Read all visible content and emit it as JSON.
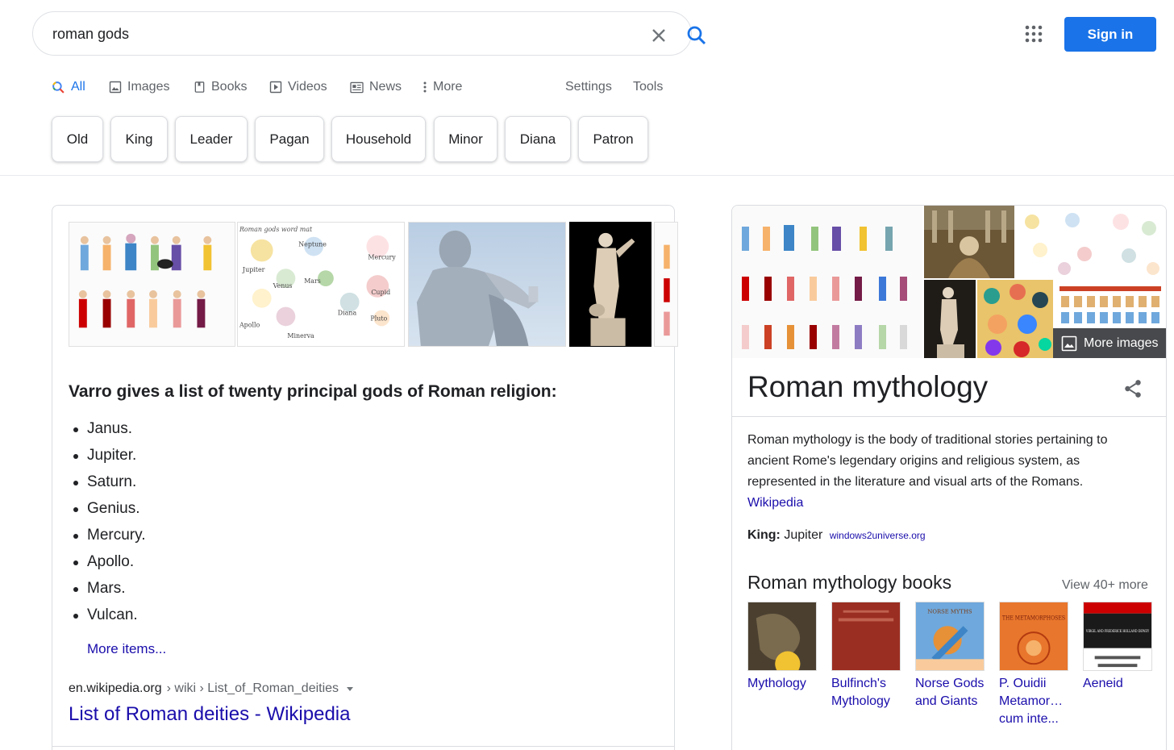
{
  "search": {
    "query": "roman gods"
  },
  "header": {
    "sign_in": "Sign in"
  },
  "tabs": {
    "all": "All",
    "images": "Images",
    "books": "Books",
    "videos": "Videos",
    "news": "News",
    "more": "More",
    "settings": "Settings",
    "tools": "Tools"
  },
  "chips": [
    "Old",
    "King",
    "Leader",
    "Pagan",
    "Household",
    "Minor",
    "Diana",
    "Patron"
  ],
  "featured_snippet": {
    "heading": "Varro gives a list of twenty principal gods of Roman religion:",
    "items": [
      "Janus.",
      "Jupiter.",
      "Saturn.",
      "Genius.",
      "Mercury.",
      "Apollo.",
      "Mars.",
      "Vulcan."
    ],
    "more_items": "More items...",
    "breadcrumb_domain": "en.wikipedia.org",
    "breadcrumb_path": "› wiki › List_of_Roman_deities",
    "result_title": "List of Roman deities - Wikipedia",
    "thumbnail_text": {
      "mat_title": "Roman gods word mat",
      "labels": [
        "Neptune",
        "Mercury",
        "Jupiter",
        "Venus",
        "Mars",
        "Cupid",
        "Apollo",
        "Diana",
        "Pluto",
        "Minerva"
      ]
    }
  },
  "knowledge_panel": {
    "more_images": "More images",
    "title": "Roman mythology",
    "description": "Roman mythology is the body of traditional stories pertaining to ancient Rome's legendary origins and religious system, as represented in the literature and visual arts of the Romans.",
    "source": "Wikipedia",
    "fact_label": "King:",
    "fact_value": "Jupiter",
    "fact_source": "windows2universe.org",
    "books_heading": "Roman mythology books",
    "view_more": "View 40+ more",
    "books": [
      {
        "title": "Mythology",
        "cover_color": "#6b5a3c"
      },
      {
        "title": "Bulfinch's Mythology",
        "cover_color": "#9a2e22"
      },
      {
        "title": "Norse Gods and Giants",
        "cover_color": "#5b9bc9",
        "cover_text": "NORSE MYTHS"
      },
      {
        "title": "P. Ouidii Metamor… cum inte...",
        "cover_color": "#e8762c",
        "cover_text": "THE METAMORPHOSES"
      },
      {
        "title": "Aeneid",
        "cover_color": "#1a1a1a",
        "cover_text": "VIRGIL AND FREDERICK HOLLAND DEWEY"
      }
    ]
  },
  "colors": {
    "accent": "#1a73e8",
    "link": "#1a0dab"
  }
}
